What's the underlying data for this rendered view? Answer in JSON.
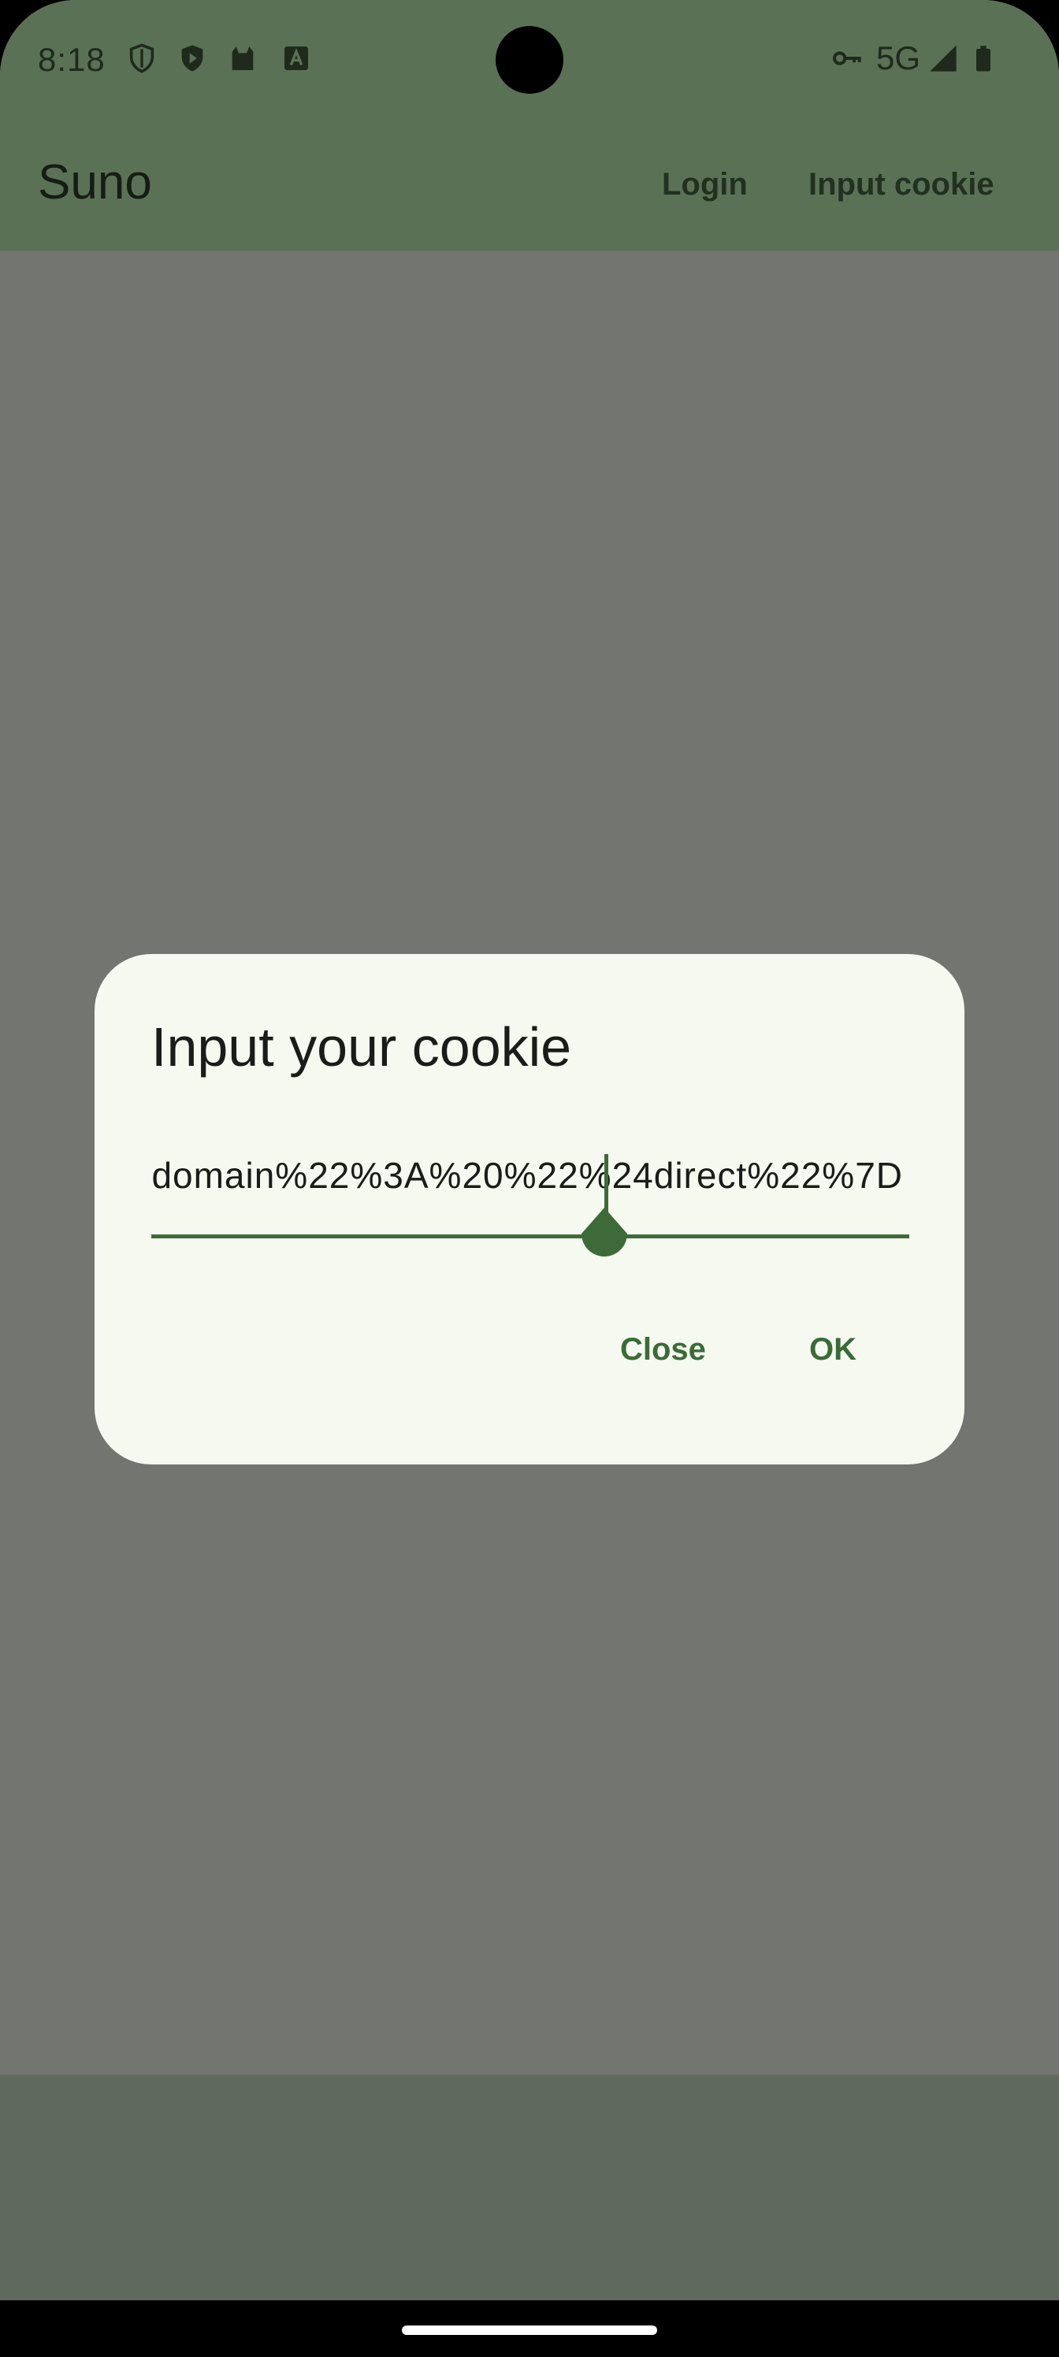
{
  "status_bar": {
    "time": "8:18",
    "network": "5G",
    "icons": [
      "shield-outline-icon",
      "shield-play-icon",
      "cat-icon",
      "font-a-icon",
      "vpn-key-icon",
      "signal-icon",
      "battery-icon"
    ]
  },
  "app_bar": {
    "title": "Suno",
    "actions": [
      "Login",
      "Input cookie"
    ]
  },
  "dialog": {
    "title": "Input your cookie",
    "field_value": "domain%22%3A%20%22%24direct%22%7D",
    "close_label": "Close",
    "ok_label": "OK"
  },
  "colors": {
    "primary": "#3e6a3a",
    "scrim": "#727570",
    "dialog_surface": "#f6f9f0"
  }
}
